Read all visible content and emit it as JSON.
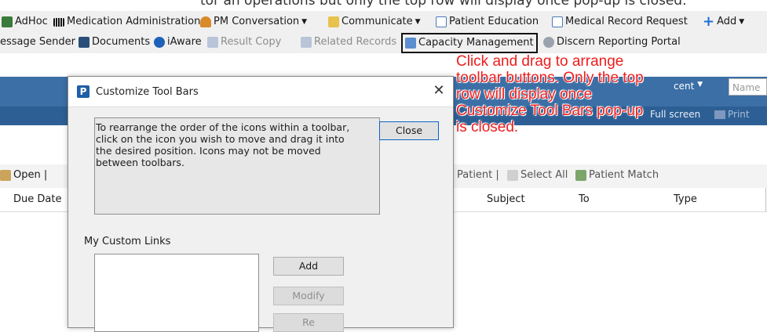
{
  "top_note": {
    "text": "tor an operations but only the top row will display once pop-up is closed."
  },
  "toolbar1": {
    "adhoc": "AdHoc",
    "med_admin": "Medication Administration",
    "pm_conversation": "PM Conversation",
    "communicate": "Communicate",
    "patient_education": "Patient Education",
    "medical_record_request": "Medical Record Request",
    "add": "Add"
  },
  "toolbar2": {
    "message_sender": "essage Sender",
    "documents": "Documents",
    "iaware": "iAware",
    "result_copy": "Result Copy",
    "related_records": "Related Records",
    "capacity_management": "Capacity Management",
    "discern_reporting_portal": "Discern Reporting Portal"
  },
  "banner": {
    "recent": "cent",
    "name_placeholder": "Name",
    "full_screen": "Full screen",
    "print": "Print"
  },
  "list_toolbar": {
    "open": "Open |",
    "patient": "Patient |",
    "select_all": "Select All",
    "patient_match": "Patient Match"
  },
  "table": {
    "columns": [
      "Due Date",
      "Subject",
      "To",
      "Type"
    ]
  },
  "dialog": {
    "title": "Customize Tool Bars",
    "close_x": "✕",
    "instructions_line1": "To rearrange the order of the icons within a toolbar,",
    "instructions_line2": "click on the icon you wish to move and drag it into",
    "instructions_line3": "the desired position. Icons may not be moved",
    "instructions_line4": "between toolbars.",
    "close_button": "Close",
    "my_custom_links": "My Custom Links",
    "add_button": "Add",
    "modify_button": "Modify",
    "remove_button": "Re"
  },
  "annotation": {
    "line1": "Click and drag to arrange",
    "line2": "toolbar buttons. Only the top",
    "line3": "row will display once",
    "line4": "Customize Tool Bars pop-up",
    "line5": "is closed."
  },
  "colors": {
    "annotation_red": "#ee1c1c",
    "banner_blue": "#3b6fa5",
    "dialog_logo_blue": "#1f5fa8"
  }
}
